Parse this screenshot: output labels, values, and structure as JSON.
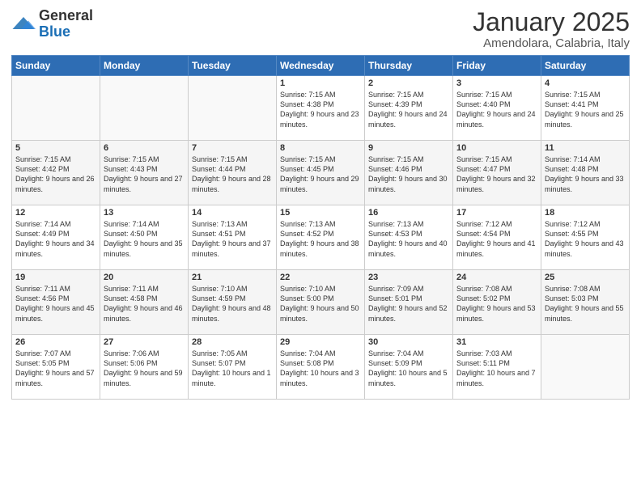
{
  "header": {
    "logo_general": "General",
    "logo_blue": "Blue",
    "month_year": "January 2025",
    "location": "Amendolara, Calabria, Italy"
  },
  "weekdays": [
    "Sunday",
    "Monday",
    "Tuesday",
    "Wednesday",
    "Thursday",
    "Friday",
    "Saturday"
  ],
  "weeks": [
    [
      {
        "day": "",
        "info": ""
      },
      {
        "day": "",
        "info": ""
      },
      {
        "day": "",
        "info": ""
      },
      {
        "day": "1",
        "info": "Sunrise: 7:15 AM\nSunset: 4:38 PM\nDaylight: 9 hours and 23 minutes."
      },
      {
        "day": "2",
        "info": "Sunrise: 7:15 AM\nSunset: 4:39 PM\nDaylight: 9 hours and 24 minutes."
      },
      {
        "day": "3",
        "info": "Sunrise: 7:15 AM\nSunset: 4:40 PM\nDaylight: 9 hours and 24 minutes."
      },
      {
        "day": "4",
        "info": "Sunrise: 7:15 AM\nSunset: 4:41 PM\nDaylight: 9 hours and 25 minutes."
      }
    ],
    [
      {
        "day": "5",
        "info": "Sunrise: 7:15 AM\nSunset: 4:42 PM\nDaylight: 9 hours and 26 minutes."
      },
      {
        "day": "6",
        "info": "Sunrise: 7:15 AM\nSunset: 4:43 PM\nDaylight: 9 hours and 27 minutes."
      },
      {
        "day": "7",
        "info": "Sunrise: 7:15 AM\nSunset: 4:44 PM\nDaylight: 9 hours and 28 minutes."
      },
      {
        "day": "8",
        "info": "Sunrise: 7:15 AM\nSunset: 4:45 PM\nDaylight: 9 hours and 29 minutes."
      },
      {
        "day": "9",
        "info": "Sunrise: 7:15 AM\nSunset: 4:46 PM\nDaylight: 9 hours and 30 minutes."
      },
      {
        "day": "10",
        "info": "Sunrise: 7:15 AM\nSunset: 4:47 PM\nDaylight: 9 hours and 32 minutes."
      },
      {
        "day": "11",
        "info": "Sunrise: 7:14 AM\nSunset: 4:48 PM\nDaylight: 9 hours and 33 minutes."
      }
    ],
    [
      {
        "day": "12",
        "info": "Sunrise: 7:14 AM\nSunset: 4:49 PM\nDaylight: 9 hours and 34 minutes."
      },
      {
        "day": "13",
        "info": "Sunrise: 7:14 AM\nSunset: 4:50 PM\nDaylight: 9 hours and 35 minutes."
      },
      {
        "day": "14",
        "info": "Sunrise: 7:13 AM\nSunset: 4:51 PM\nDaylight: 9 hours and 37 minutes."
      },
      {
        "day": "15",
        "info": "Sunrise: 7:13 AM\nSunset: 4:52 PM\nDaylight: 9 hours and 38 minutes."
      },
      {
        "day": "16",
        "info": "Sunrise: 7:13 AM\nSunset: 4:53 PM\nDaylight: 9 hours and 40 minutes."
      },
      {
        "day": "17",
        "info": "Sunrise: 7:12 AM\nSunset: 4:54 PM\nDaylight: 9 hours and 41 minutes."
      },
      {
        "day": "18",
        "info": "Sunrise: 7:12 AM\nSunset: 4:55 PM\nDaylight: 9 hours and 43 minutes."
      }
    ],
    [
      {
        "day": "19",
        "info": "Sunrise: 7:11 AM\nSunset: 4:56 PM\nDaylight: 9 hours and 45 minutes."
      },
      {
        "day": "20",
        "info": "Sunrise: 7:11 AM\nSunset: 4:58 PM\nDaylight: 9 hours and 46 minutes."
      },
      {
        "day": "21",
        "info": "Sunrise: 7:10 AM\nSunset: 4:59 PM\nDaylight: 9 hours and 48 minutes."
      },
      {
        "day": "22",
        "info": "Sunrise: 7:10 AM\nSunset: 5:00 PM\nDaylight: 9 hours and 50 minutes."
      },
      {
        "day": "23",
        "info": "Sunrise: 7:09 AM\nSunset: 5:01 PM\nDaylight: 9 hours and 52 minutes."
      },
      {
        "day": "24",
        "info": "Sunrise: 7:08 AM\nSunset: 5:02 PM\nDaylight: 9 hours and 53 minutes."
      },
      {
        "day": "25",
        "info": "Sunrise: 7:08 AM\nSunset: 5:03 PM\nDaylight: 9 hours and 55 minutes."
      }
    ],
    [
      {
        "day": "26",
        "info": "Sunrise: 7:07 AM\nSunset: 5:05 PM\nDaylight: 9 hours and 57 minutes."
      },
      {
        "day": "27",
        "info": "Sunrise: 7:06 AM\nSunset: 5:06 PM\nDaylight: 9 hours and 59 minutes."
      },
      {
        "day": "28",
        "info": "Sunrise: 7:05 AM\nSunset: 5:07 PM\nDaylight: 10 hours and 1 minute."
      },
      {
        "day": "29",
        "info": "Sunrise: 7:04 AM\nSunset: 5:08 PM\nDaylight: 10 hours and 3 minutes."
      },
      {
        "day": "30",
        "info": "Sunrise: 7:04 AM\nSunset: 5:09 PM\nDaylight: 10 hours and 5 minutes."
      },
      {
        "day": "31",
        "info": "Sunrise: 7:03 AM\nSunset: 5:11 PM\nDaylight: 10 hours and 7 minutes."
      },
      {
        "day": "",
        "info": ""
      }
    ]
  ]
}
